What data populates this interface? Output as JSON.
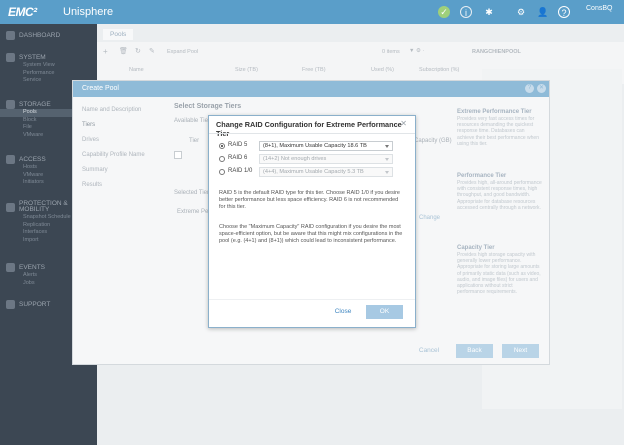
{
  "app": {
    "brand": "EMC²",
    "product": "Unisphere",
    "user_badge": "ConsBQ"
  },
  "colors": {
    "topbar": "#5a9ec9",
    "sidebar": "#3c4753",
    "accent": "#3f86c1"
  },
  "sidebar": {
    "sections": [
      {
        "label": "DASHBOARD",
        "icon": "dashboard-icon",
        "items": []
      },
      {
        "label": "SYSTEM",
        "icon": "system-icon",
        "items": [
          "System View",
          "Performance",
          "Service"
        ]
      },
      {
        "label": "STORAGE",
        "icon": "storage-icon",
        "items": [
          "Pools",
          "Block",
          "File",
          "VMware"
        ]
      },
      {
        "label": "ACCESS",
        "icon": "access-icon",
        "items": [
          "Hosts",
          "VMware",
          "Initiators"
        ]
      },
      {
        "label": "PROTECTION & MOBILITY",
        "icon": "protection-icon",
        "items": [
          "Snapshot Schedule",
          "Replication",
          "Interfaces",
          "Import"
        ]
      },
      {
        "label": "EVENTS",
        "icon": "events-icon",
        "items": [
          "Alerts",
          "Jobs"
        ]
      },
      {
        "label": "SUPPORT",
        "icon": "support-icon",
        "items": []
      }
    ]
  },
  "background": {
    "tab": "Pools",
    "expand_label": "Expand Pool",
    "items_count": "0 items",
    "pool_name": "RANGCHIENPOOL",
    "columns": [
      "Name",
      "Size (TB)",
      "Free (TB)",
      "Used (%)",
      "Subscription (%)"
    ]
  },
  "wizard": {
    "title": "Create Pool",
    "steps": [
      "Name and Description",
      "Tiers",
      "Drives",
      "Capability Profile Name",
      "Summary",
      "Results"
    ],
    "heading": "Select Storage Tiers",
    "available_label": "Available Tiers",
    "tier_col": "Tier",
    "capacity_col": "Capacity (GB)",
    "selected_label": "Selected Tiers",
    "extreme_label": "Extreme Performance",
    "change_label": "Change",
    "tiers": [
      {
        "title": "Extreme Performance Tier",
        "desc": "Provides very fast access times for resources demanding the quickest response time. Databases can achieve their best performance when using this tier."
      },
      {
        "title": "Performance Tier",
        "desc": "Provides high, all-around performance with consistent response times, high throughput, and good bandwidth. Appropriate for database resources accessed centrally through a network."
      },
      {
        "title": "Capacity Tier",
        "desc": "Provides high storage capacity with generally lower performance. Appropriate for storing large amounts of primarily static data (such as video, audio, and image files) for users and applications without strict performance requirements."
      }
    ],
    "buttons": {
      "cancel": "Cancel",
      "back": "Back",
      "next": "Next"
    }
  },
  "dialog": {
    "title": "Change RAID Configuration for Extreme Performance Tier",
    "options": [
      {
        "label": "RAID 5",
        "value": "(8+1), Maximum Usable Capacity 18.6 TB",
        "selected": true,
        "enabled": true
      },
      {
        "label": "RAID 6",
        "value": "(14+2) Not enough drives",
        "selected": false,
        "enabled": false
      },
      {
        "label": "RAID 1/0",
        "value": "(4+4), Maximum Usable Capacity 5.3 TB",
        "selected": false,
        "enabled": false
      }
    ],
    "para1": "RAID 5 is the default RAID type for this tier. Choose RAID 1/0 if you desire better performance but less space efficiency. RAID 6 is not recommended for this tier.",
    "para2": "Choose the \"Maximum Capacity\" RAID configuration if you desire the most space-efficient option, but be aware that this might mix configurations in the pool (e.g. (4+1) and (8+1)) which could lead to inconsistent performance.",
    "close_label": "Close",
    "ok_label": "OK"
  }
}
